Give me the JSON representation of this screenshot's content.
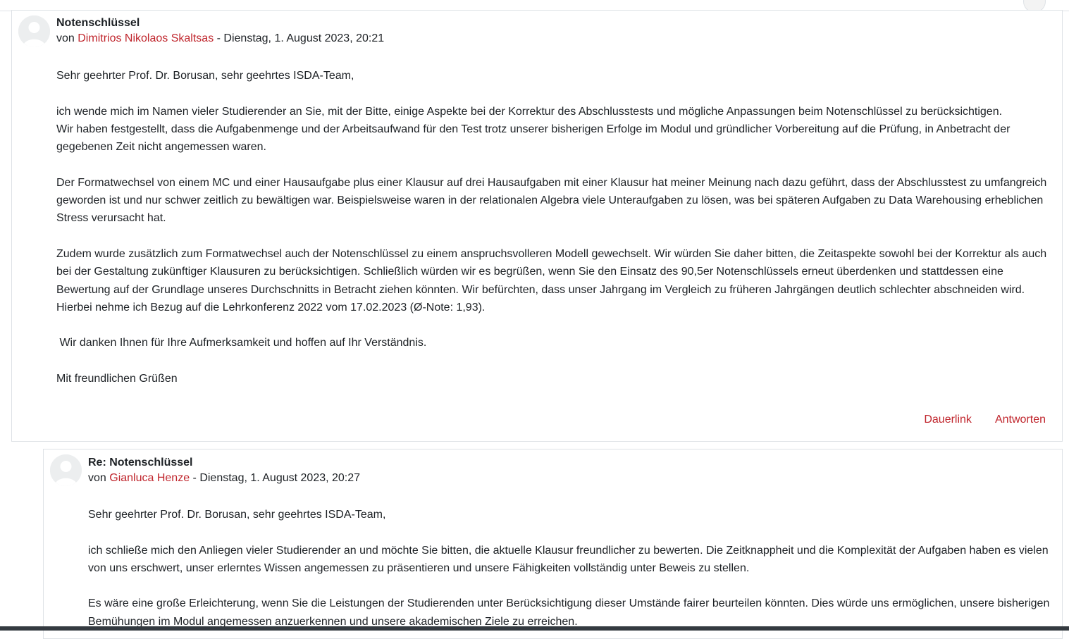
{
  "posts": [
    {
      "subject": "Notenschlüssel",
      "by_prefix": "von",
      "author": "Dimitrios Nikolaos Skaltsas",
      "date_sep": " - ",
      "date": "Dienstag, 1. August 2023, 20:21",
      "paragraphs": [
        "Sehr geehrter Prof. Dr. Borusan, sehr geehrtes ISDA-Team,",
        "",
        "ich wende mich im Namen vieler Studierender an Sie, mit der Bitte, einige Aspekte bei der Korrektur des Abschlusstests und mögliche Anpassungen beim Notenschlüssel zu berücksichtigen.",
        "Wir haben festgestellt, dass die Aufgabenmenge und der Arbeitsaufwand für den Test trotz unserer bisherigen Erfolge im Modul und gründlicher Vorbereitung auf die Prüfung, in Anbetracht der gegebenen Zeit nicht angemessen waren.",
        "",
        "Der Formatwechsel von einem MC und einer Hausaufgabe plus einer Klausur auf drei Hausaufgaben mit einer Klausur hat meiner Meinung nach dazu geführt, dass der Abschlusstest zu umfangreich geworden ist und nur schwer zeitlich zu bewältigen war. Beispielsweise waren in der relationalen Algebra viele Unteraufgaben zu lösen, was bei späteren Aufgaben zu Data Warehousing erheblichen Stress verursacht hat.",
        "",
        "Zudem wurde zusätzlich zum Formatwechsel auch der Notenschlüssel zu einem anspruchsvolleren Modell gewechselt. Wir würden Sie daher bitten, die Zeitaspekte sowohl bei der Korrektur als auch bei der Gestaltung zukünftiger Klausuren zu berücksichtigen. Schließlich würden wir es begrüßen, wenn Sie den Einsatz des 90,5er Notenschlüssels erneut überdenken und stattdessen eine Bewertung auf der Grundlage unseres Durchschnitts in Betracht ziehen könnten. Wir befürchten, dass unser Jahrgang im Vergleich zu früheren Jahrgängen deutlich schlechter abschneiden wird. Hierbei nehme ich Bezug auf die Lehrkonferenz 2022 vom 17.02.2023 (Ø-Note: 1,93).",
        "",
        " Wir danken Ihnen für Ihre Aufmerksamkeit und hoffen auf Ihr Verständnis.",
        "",
        "Mit freundlichen Grüßen"
      ],
      "permalink_label": "Dauerlink",
      "reply_label": "Antworten"
    },
    {
      "subject": "Re: Notenschlüssel",
      "by_prefix": "von",
      "author": "Gianluca Henze",
      "date_sep": " - ",
      "date": "Dienstag, 1. August 2023, 20:27",
      "paragraphs": [
        "Sehr geehrter Prof. Dr. Borusan, sehr geehrtes ISDA-Team,",
        "",
        "ich schließe mich den Anliegen vieler Studierender an und möchte Sie bitten, die aktuelle Klausur freundlicher zu bewerten. Die Zeitknappheit und die Komplexität der Aufgaben haben es vielen von uns erschwert, unser erlerntes Wissen angemessen zu präsentieren und unsere Fähigkeiten vollständig unter Beweis zu stellen.",
        "",
        "Es wäre eine große Erleichterung, wenn Sie die Leistungen der Studierenden unter Berücksichtigung dieser Umstände fairer beurteilen könnten. Dies würde uns ermöglichen, unsere bisherigen Bemühungen im Modul angemessen anzuerkennen und unsere akademischen Ziele zu erreichen."
      ]
    }
  ],
  "icons": {
    "avatar": "user-avatar-icon"
  },
  "colors": {
    "link": "#c0262d",
    "text": "#1d2125",
    "border": "#dee2e6"
  }
}
